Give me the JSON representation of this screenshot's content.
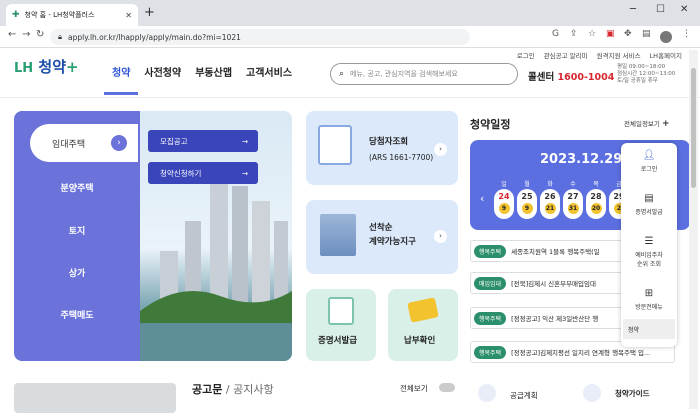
{
  "browser": {
    "tab_title": "청약 홈 - LH청약플러스",
    "url": "apply.lh.or.kr/lhapply/apply/main.do?mi=1021",
    "new_tab_icon": "+"
  },
  "util": [
    "로그인",
    "관심공고 알리미",
    "원격지원 서비스",
    "LH홈페이지"
  ],
  "logo": {
    "lh": "LH",
    "text": "청약",
    "plus": "+"
  },
  "gnb": [
    "청약",
    "사전청약",
    "부동산맵",
    "고객서비스"
  ],
  "search": {
    "placeholder": "메뉴, 공고, 관심지역을 검색해보세요"
  },
  "call": {
    "label": "콜센터",
    "num": "1600-1004"
  },
  "hours": [
    "평일 09:00~18:00",
    "점심시간 12:00~13:00",
    "토/일 공휴일 휴무"
  ],
  "lmenu": {
    "active": "임대주택",
    "items": [
      "분양주택",
      "토지",
      "상가",
      "주택매도"
    ]
  },
  "sub": {
    "b1": "모집공고",
    "b2": "청약신청하기",
    "arrow": "→"
  },
  "cards": {
    "c1a": "당첨자조회",
    "c1b": "(ARS 1661-7700)",
    "c2a": "선착순",
    "c2b": "계약가능지구",
    "c3": "증명서발급",
    "c4": "납부확인",
    "arrow": "›"
  },
  "schedule": {
    "title": "청약일정",
    "more": "전체일정보기",
    "date": "2023.12.29",
    "days": [
      {
        "w": "일",
        "d": "24",
        "c": "9"
      },
      {
        "w": "월",
        "d": "25",
        "c": "9"
      },
      {
        "w": "화",
        "d": "26",
        "c": "21"
      },
      {
        "w": "수",
        "d": "27",
        "c": "31"
      },
      {
        "w": "목",
        "d": "28",
        "c": "20"
      },
      {
        "w": "금",
        "d": "29",
        "c": "2"
      }
    ],
    "rows": [
      {
        "tag": "행복주택",
        "text": "세종조치원역 1블록 행복주택(일"
      },
      {
        "tag": "매입임대",
        "text": "[전북]김제시 신혼부부매입임대"
      },
      {
        "tag": "행복주택",
        "text": "[정정공고] 익산 제3일반산단 행"
      },
      {
        "tag": "행복주택",
        "text": "[정정공고]김제지평선 일지리 연계형 행복주택 입..."
      }
    ]
  },
  "side": {
    "login": "로그인",
    "cert": "증명서발급",
    "wait1": "예비입주자",
    "wait2": "순위 조회",
    "visit": "방문전메뉴",
    "active": "청약"
  },
  "bottom": {
    "notice": "공고문",
    "sep": "/",
    "notice2": "공지사항",
    "allview": "전체보기",
    "plan": "공급계획",
    "guide": "청약가이드"
  }
}
